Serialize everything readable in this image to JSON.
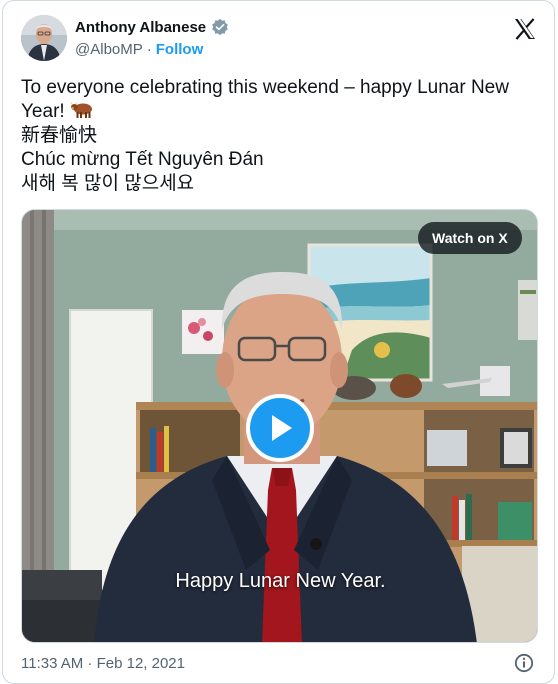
{
  "author": {
    "name": "Anthony Albanese",
    "handle": "@AlboMP",
    "separator": "·",
    "follow_label": "Follow",
    "verified_icon": "verified-badge-icon",
    "colors": {
      "accent": "#1d9bf0",
      "secondary_text": "#536471"
    }
  },
  "tweet": {
    "lines": [
      "To everyone celebrating this weekend – happy Lunar New",
      "Year!",
      "新春愉快",
      "Chúc mừng Tết Nguyên Đán",
      "새해 복 많이 많으세요"
    ],
    "emoji_icon": "ox-emoji-icon"
  },
  "media": {
    "watch_label": "Watch on X",
    "caption": "Happy Lunar New Year.",
    "play_icon": "play-icon"
  },
  "footer": {
    "timestamp": "11:33 AM · Feb 12, 2021",
    "info_icon": "info-icon"
  }
}
